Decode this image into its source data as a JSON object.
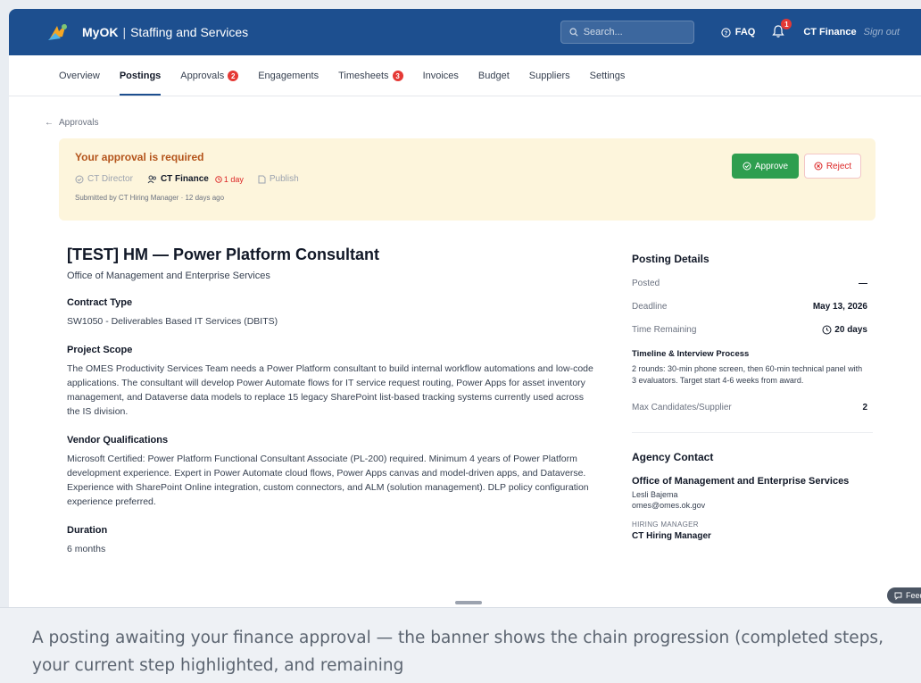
{
  "header": {
    "brand": "MyOK",
    "separator": "|",
    "app_name": "Staffing and Services",
    "search_placeholder": "Search...",
    "faq_label": "FAQ",
    "notification_count": "1",
    "user_name": "CT Finance",
    "signout_label": "Sign out",
    "brand_color": "#1d4f8f"
  },
  "tabs": [
    {
      "label": "Overview",
      "count": null,
      "active": false
    },
    {
      "label": "Postings",
      "count": null,
      "active": true
    },
    {
      "label": "Approvals",
      "count": "2",
      "active": false
    },
    {
      "label": "Engagements",
      "count": null,
      "active": false
    },
    {
      "label": "Timesheets",
      "count": "3",
      "active": false
    },
    {
      "label": "Invoices",
      "count": null,
      "active": false
    },
    {
      "label": "Budget",
      "count": null,
      "active": false
    },
    {
      "label": "Suppliers",
      "count": null,
      "active": false
    },
    {
      "label": "Settings",
      "count": null,
      "active": false
    }
  ],
  "breadcrumb": {
    "back_label": "Approvals"
  },
  "banner": {
    "title": "Your approval is required",
    "steps": [
      {
        "label": "CT Director",
        "state": "done"
      },
      {
        "label": "CT Finance",
        "state": "current",
        "duration": "1 day"
      },
      {
        "label": "Publish",
        "state": "pending"
      }
    ],
    "submitted": "Submitted by CT Hiring Manager · 12 days ago",
    "approve_label": "Approve",
    "reject_label": "Reject",
    "approve_color": "#2e9e4f",
    "reject_color": "#dc2626"
  },
  "posting": {
    "title": "[TEST] HM — Power Platform Consultant",
    "agency": "Office of Management and Enterprise Services",
    "sections": [
      {
        "heading": "Contract Type",
        "body": "SW1050 - Deliverables Based IT Services (DBITS)"
      },
      {
        "heading": "Project Scope",
        "body": "The OMES Productivity Services Team needs a Power Platform consultant to build internal workflow automations and low-code applications. The consultant will develop Power Automate flows for IT service request routing, Power Apps for asset inventory management, and Dataverse data models to replace 15 legacy SharePoint list-based tracking systems currently used across the IS division."
      },
      {
        "heading": "Vendor Qualifications",
        "body": "Microsoft Certified: Power Platform Functional Consultant Associate (PL-200) required. Minimum 4 years of Power Platform development experience. Expert in Power Automate cloud flows, Power Apps canvas and model-driven apps, and Dataverse. Experience with SharePoint Online integration, custom connectors, and ALM (solution management). DLP policy configuration experience preferred."
      },
      {
        "heading": "Duration",
        "body": "6 months"
      }
    ]
  },
  "details": {
    "heading": "Posting Details",
    "posted_label": "Posted",
    "posted_value": "—",
    "deadline_label": "Deadline",
    "deadline_value": "May 13, 2026",
    "remaining_label": "Time Remaining",
    "remaining_value": "20 days",
    "timeline_heading": "Timeline & Interview Process",
    "timeline_body": "2 rounds: 30-min phone screen, then 60-min technical panel with 3 evaluators. Target start 4-6 weeks from award.",
    "max_label": "Max Candidates/Supplier",
    "max_value": "2"
  },
  "contact": {
    "heading": "Agency Contact",
    "org": "Office of Management and Enterprise Services",
    "name": "Lesli Bajema",
    "email": "omes@omes.ok.gov",
    "hm_label": "HIRING MANAGER",
    "hm_name": "CT Hiring Manager"
  },
  "feedback_label": "Feedb",
  "caption": "A posting awaiting your finance approval — the banner shows the chain progression (completed steps, your current step highlighted, and remaining"
}
